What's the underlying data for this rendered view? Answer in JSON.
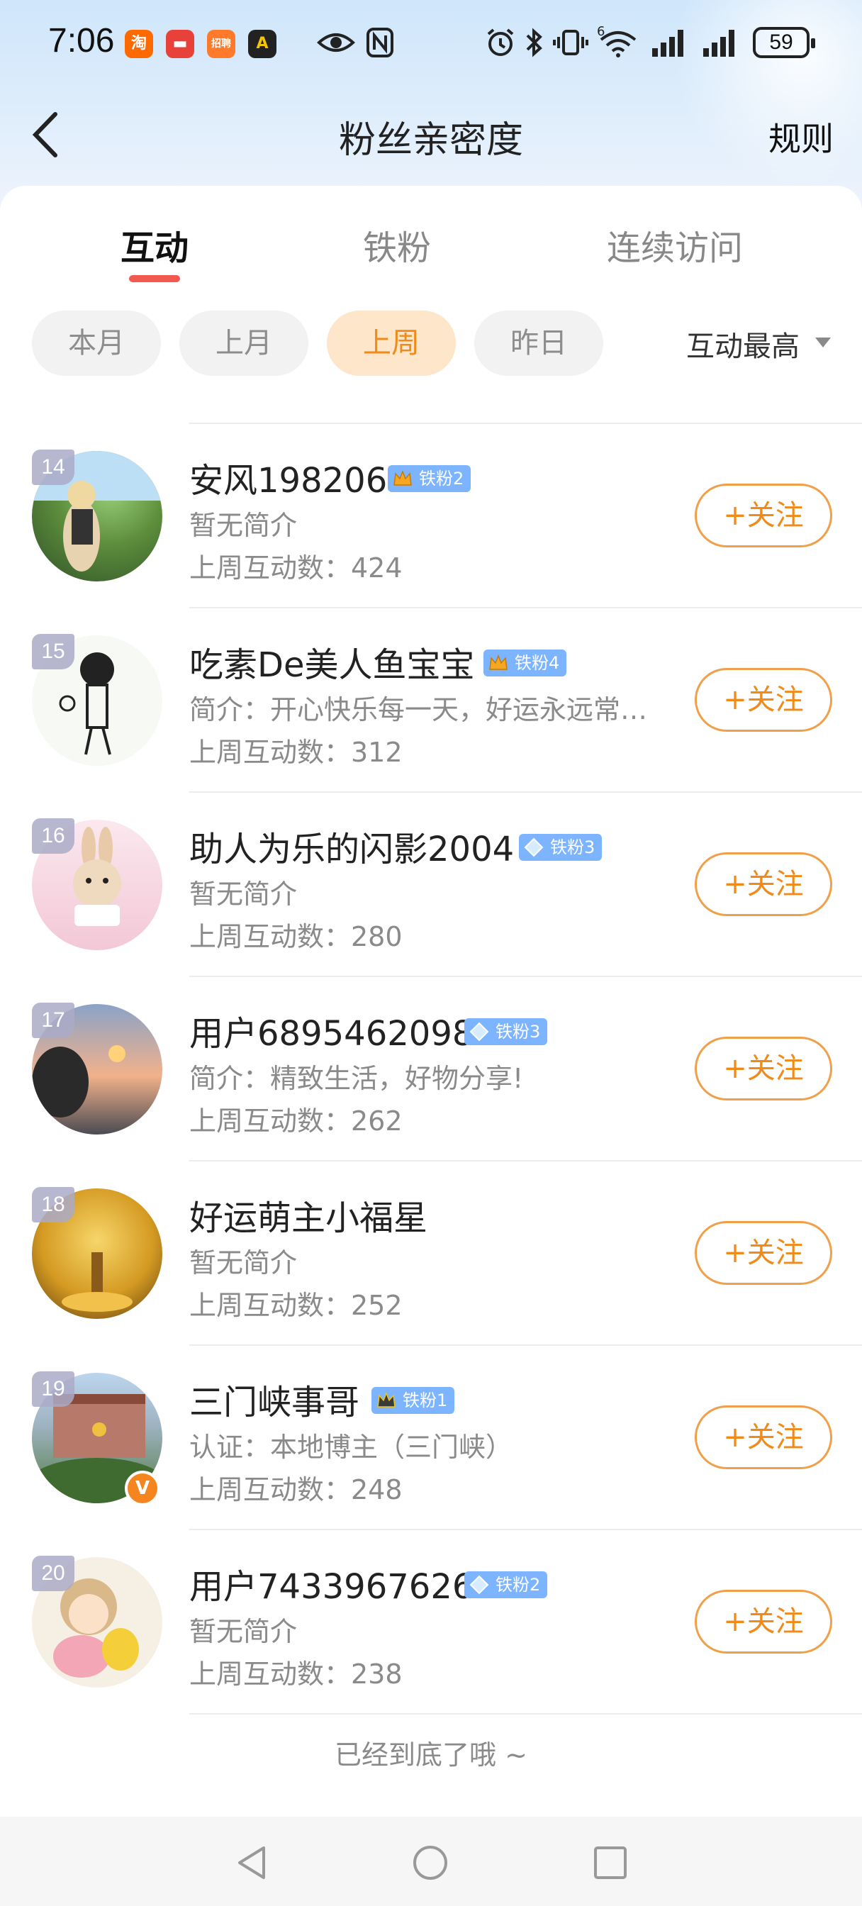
{
  "status_bar": {
    "time": "7:06",
    "app_icons": [
      {
        "name": "taobao",
        "label": "淘",
        "color": "#ff6a00"
      },
      {
        "name": "news",
        "label": "▬",
        "color": "#e8413a"
      },
      {
        "name": "recruit",
        "label": "招聘",
        "color": "#ff7a2a"
      },
      {
        "name": "car",
        "label": "A",
        "color": "#222222"
      }
    ],
    "battery": "59",
    "network": "6"
  },
  "nav": {
    "title": "粉丝亲密度",
    "rule_label": "规则"
  },
  "tabs": [
    {
      "label": "互动",
      "active": true
    },
    {
      "label": "铁粉",
      "active": false
    },
    {
      "label": "连续访问",
      "active": false
    }
  ],
  "filters": [
    {
      "label": "本月",
      "active": false
    },
    {
      "label": "上月",
      "active": false
    },
    {
      "label": "上周",
      "active": true
    },
    {
      "label": "昨日",
      "active": false
    }
  ],
  "sort_label": "互动最高",
  "follow_label": "+关注",
  "fans": [
    {
      "rank": "14",
      "name": "安风198206",
      "badge": "铁粉2",
      "badge_type": "crown-gold",
      "bio": "暂无简介",
      "count": "上周互动数：424"
    },
    {
      "rank": "15",
      "name": "吃素De美人鱼宝宝",
      "badge": "铁粉4",
      "badge_type": "crown-gold",
      "bio": "简介：开心快乐每一天，好运永远常…",
      "count": "上周互动数：312"
    },
    {
      "rank": "16",
      "name": "助人为乐的闪影2004",
      "badge": "铁粉3",
      "badge_type": "diamond",
      "bio": "暂无简介",
      "count": "上周互动数：280"
    },
    {
      "rank": "17",
      "name": "用户6895462098",
      "badge": "铁粉3",
      "badge_type": "diamond",
      "bio": "简介：精致生活，好物分享!",
      "count": "上周互动数：262"
    },
    {
      "rank": "18",
      "name": "好运萌主小福星",
      "badge": "",
      "badge_type": "",
      "bio": "暂无简介",
      "count": "上周互动数：252"
    },
    {
      "rank": "19",
      "name": "三门峡事哥",
      "badge": "铁粉1",
      "badge_type": "crown-dark",
      "bio": "认证：本地博主（三门峡）",
      "count": "上周互动数：248",
      "verified": "V"
    },
    {
      "rank": "20",
      "name": "用户7433967626",
      "badge": "铁粉2",
      "badge_type": "diamond",
      "bio": "暂无简介",
      "count": "上周互动数：238"
    }
  ],
  "end_text": "已经到底了哦 ~",
  "colors": {
    "accent_orange": "#f08a19",
    "tab_indicator": "#f25a4f",
    "badge_blue": "#7cb4ff"
  }
}
